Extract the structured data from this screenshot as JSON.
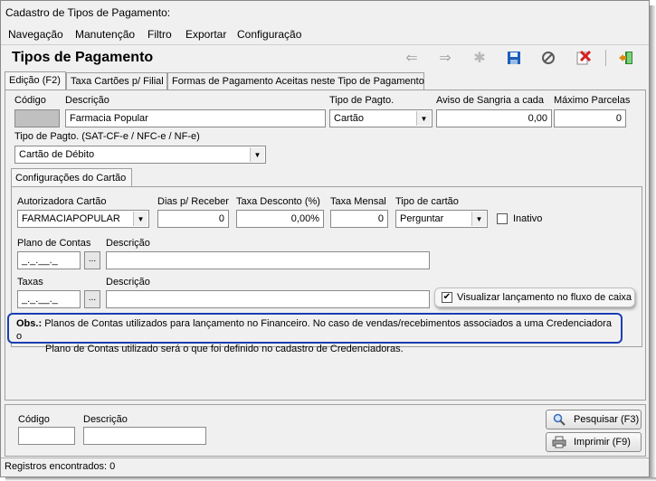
{
  "window": {
    "title": "Cadastro de Tipos de Pagamento:"
  },
  "menu": {
    "items": [
      "Navegação",
      "Manutenção",
      "Filtro",
      "Exportar",
      "Configuração"
    ]
  },
  "page": {
    "title": "Tipos de Pagamento"
  },
  "toolbar": {
    "icons": [
      "arrow-left-icon",
      "arrow-right-icon",
      "new-icon",
      "save-icon",
      "cancel-icon",
      "delete-icon",
      "exit-icon"
    ]
  },
  "tabs": [
    "Edição (F2)",
    "Taxa Cartões p/ Filial",
    "Formas de Pagamento Aceitas neste Tipo de Pagamento"
  ],
  "form": {
    "codigo_label": "Código",
    "codigo_value": "",
    "descricao_label": "Descrição",
    "descricao_value": "Farmacia Popular",
    "tipo_pagto_label": "Tipo de Pagto.",
    "tipo_pagto_value": "Cartão",
    "aviso_sangria_label": "Aviso de Sangria a cada",
    "aviso_sangria_value": "0,00",
    "max_parcelas_label": "Máximo Parcelas",
    "max_parcelas_value": "0",
    "tipo_pagto_sat_label": "Tipo de Pagto. (SAT-CF-e / NFC-e / NF-e)",
    "tipo_pagto_sat_value": "Cartão de Débito"
  },
  "subtab": {
    "label": "Configurações do Cartão"
  },
  "cartao": {
    "autorizadora_label": "Autorizadora Cartão",
    "autorizadora_value": "FARMACIAPOPULAR",
    "dias_receber_label": "Dias p/ Receber",
    "dias_receber_value": "0",
    "taxa_desconto_label": "Taxa Desconto (%)",
    "taxa_desconto_value": "0,00%",
    "taxa_mensal_label": "Taxa Mensal",
    "taxa_mensal_value": "0",
    "tipo_cartao_label": "Tipo de cartão",
    "tipo_cartao_value": "Perguntar",
    "inativo_label": "Inativo",
    "inativo_checked": false,
    "plano_contas_label": "Plano de Contas",
    "plano_contas_value": "_._.__._",
    "plano_descricao_label": "Descrição",
    "plano_descricao_value": "",
    "taxas_label": "Taxas",
    "taxas_value": "_._.__._",
    "taxas_descricao_label": "Descrição",
    "taxas_descricao_value": "",
    "ellipsis": "...",
    "visualizar_label": "Visualizar lançamento no fluxo de caixa",
    "visualizar_checked": true,
    "visualizar_mark": "✔"
  },
  "obs": {
    "prefix": "Obs.:",
    "line1": "Planos de Contas utilizados para lançamento no Financeiro. No caso de vendas/recebimentos associados a uma Credenciadora o",
    "line2": "Plano de Contas utilizado será o que foi definido no cadastro de Credenciadoras."
  },
  "search": {
    "codigo_label": "Código",
    "codigo_value": "",
    "descricao_label": "Descrição",
    "descricao_value": "",
    "pesquisar_label": "Pesquisar (F3)",
    "imprimir_label": "Imprimir (F9)"
  },
  "status": {
    "text": "Registros encontrados: 0"
  },
  "colors": {
    "obs_border": "#1a3fb4",
    "delete_red": "#d32020",
    "save_blue": "#1c5fb8"
  }
}
